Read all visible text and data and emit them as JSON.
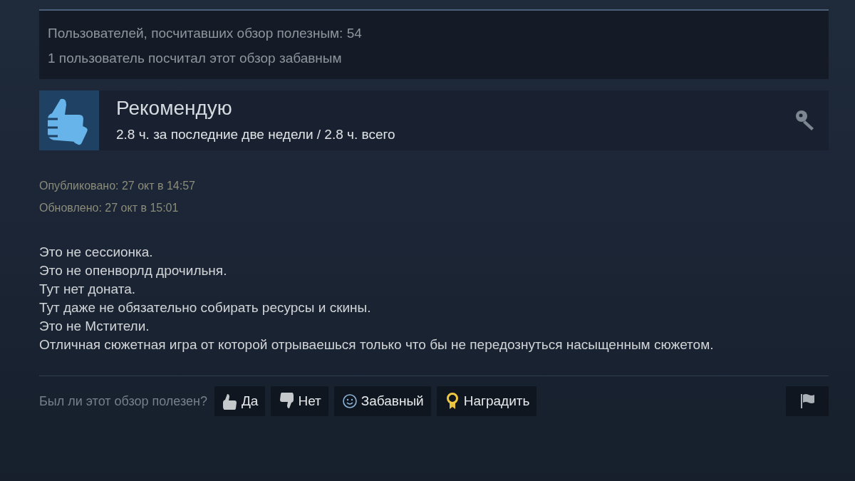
{
  "stats": [
    "Пользователей, посчитавших обзор полезным: 54",
    "1 пользователь посчитал этот обзор забавным"
  ],
  "recommendation": {
    "title": "Рекомендую",
    "hours": "2.8 ч. за последние две недели / 2.8 ч. всего"
  },
  "dates": [
    "Опубликовано: 27 окт в 14:57",
    "Обновлено: 27 окт в 15:01"
  ],
  "review_lines": [
    "Это не сессионка.",
    "Это не опенворлд дрочильня.",
    "Тут нет доната.",
    "Тут даже не обязательно собирать ресурсы и скины.",
    "Это не Мстители.",
    "Отличная сюжетная игра от которой отрываешься только что бы не передознуться насыщенным сюжетом."
  ],
  "vote": {
    "question": "Был ли этот обзор полезен?",
    "buttons": [
      {
        "kind": "thumbs_up",
        "label": "Да"
      },
      {
        "kind": "thumbs_down",
        "label": "Нет"
      },
      {
        "kind": "smiley",
        "label": "Забавный"
      },
      {
        "kind": "award",
        "label": "Наградить"
      }
    ]
  }
}
